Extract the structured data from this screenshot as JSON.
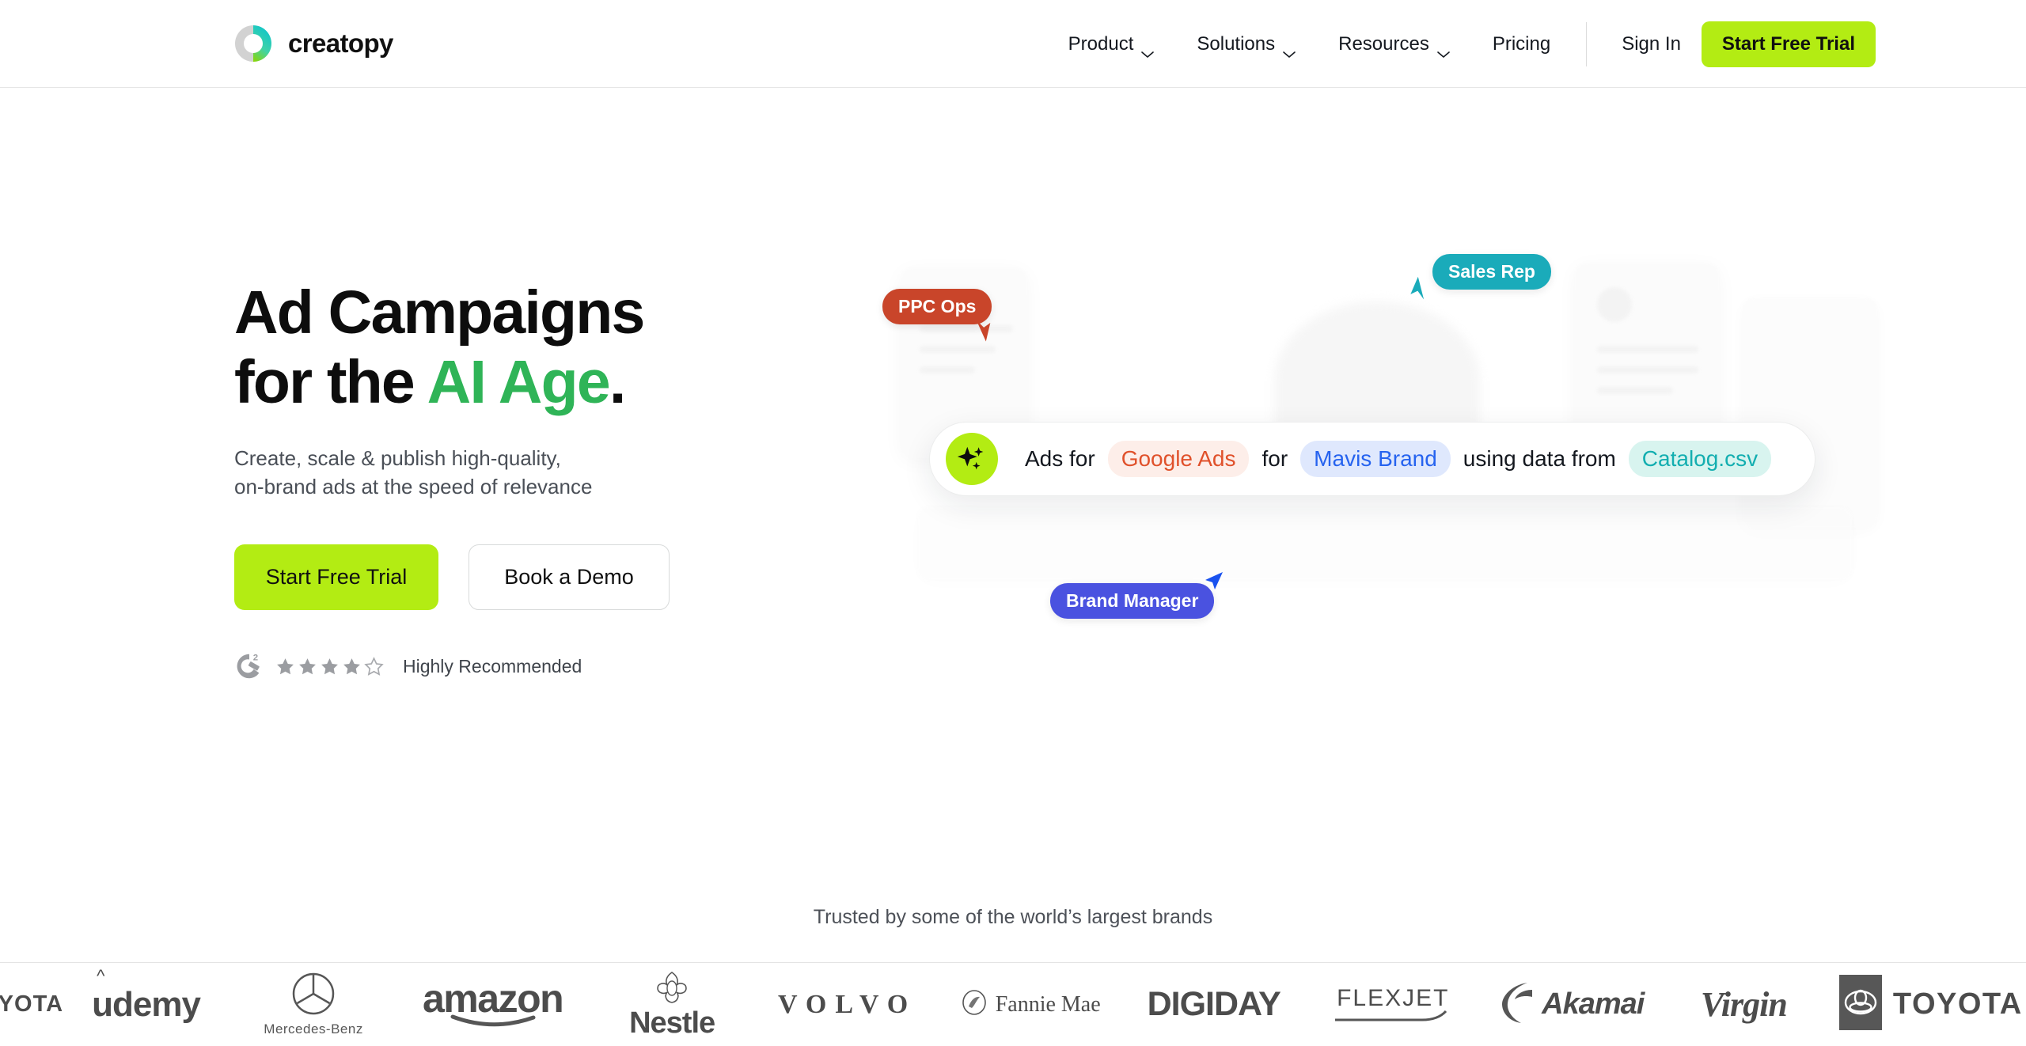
{
  "header": {
    "brand": {
      "name": "creatopy",
      "logo_icon": "creatopy-ring-logo"
    },
    "nav": [
      {
        "label": "Product",
        "has_dropdown": true
      },
      {
        "label": "Solutions",
        "has_dropdown": true
      },
      {
        "label": "Resources",
        "has_dropdown": true
      },
      {
        "label": "Pricing",
        "has_dropdown": false
      }
    ],
    "sign_in": "Sign In",
    "cta": "Start Free Trial"
  },
  "hero": {
    "title_line1": "Ad Campaigns",
    "title_line2_lead": "for the ",
    "title_line2_accent": "AI Age",
    "title_line2_tail": ".",
    "subtitle_line1": "Create, scale & publish high-quality,",
    "subtitle_line2": "on-brand ads at the speed of relevance",
    "primary_cta": "Start Free Trial",
    "secondary_cta": "Book a Demo",
    "rating": {
      "badge": "G2",
      "stars_filled": 4,
      "stars_half": 1,
      "stars_total": 5,
      "label": "Highly Recommended"
    }
  },
  "illustration": {
    "prompt": {
      "icon": "ai-sparkle-icon",
      "token1": "Ads for",
      "chip1": "Google Ads",
      "token2": "for",
      "chip2": "Mavis Brand",
      "token3": "using data from",
      "chip3": "Catalog.csv"
    },
    "roles": [
      {
        "label": "PPC Ops",
        "color": "#c9452a"
      },
      {
        "label": "Sales Rep",
        "color": "#1aabba"
      },
      {
        "label": "Brand Manager",
        "color": "#4a52e0"
      }
    ]
  },
  "trusted": {
    "caption": "Trusted by some of the world’s largest brands",
    "logos": [
      {
        "name": "TOYOTA",
        "icon": "toyota-logo"
      },
      {
        "name": "udemy",
        "icon": "udemy-logo"
      },
      {
        "name": "Mercedes-Benz",
        "icon": "mercedes-benz-logo"
      },
      {
        "name": "amazon",
        "icon": "amazon-logo"
      },
      {
        "name": "Nestle",
        "icon": "nestle-logo"
      },
      {
        "name": "VOLVO",
        "icon": "volvo-logo"
      },
      {
        "name": "Fannie Mae",
        "icon": "fannie-mae-logo"
      },
      {
        "name": "DIGIDAY",
        "icon": "digiday-logo"
      },
      {
        "name": "FLEXJET",
        "icon": "flexjet-logo"
      },
      {
        "name": "Akamai",
        "icon": "akamai-logo"
      },
      {
        "name": "Virgin",
        "icon": "virgin-logo"
      },
      {
        "name": "TOYOTA",
        "icon": "toyota-logo"
      }
    ]
  },
  "colors": {
    "lime": "#b3ec13",
    "green_accent": "#2fb457",
    "chip_red": "#e0512b",
    "chip_blue": "#2663ef",
    "chip_teal": "#13aeb0",
    "text": "#14181f"
  }
}
